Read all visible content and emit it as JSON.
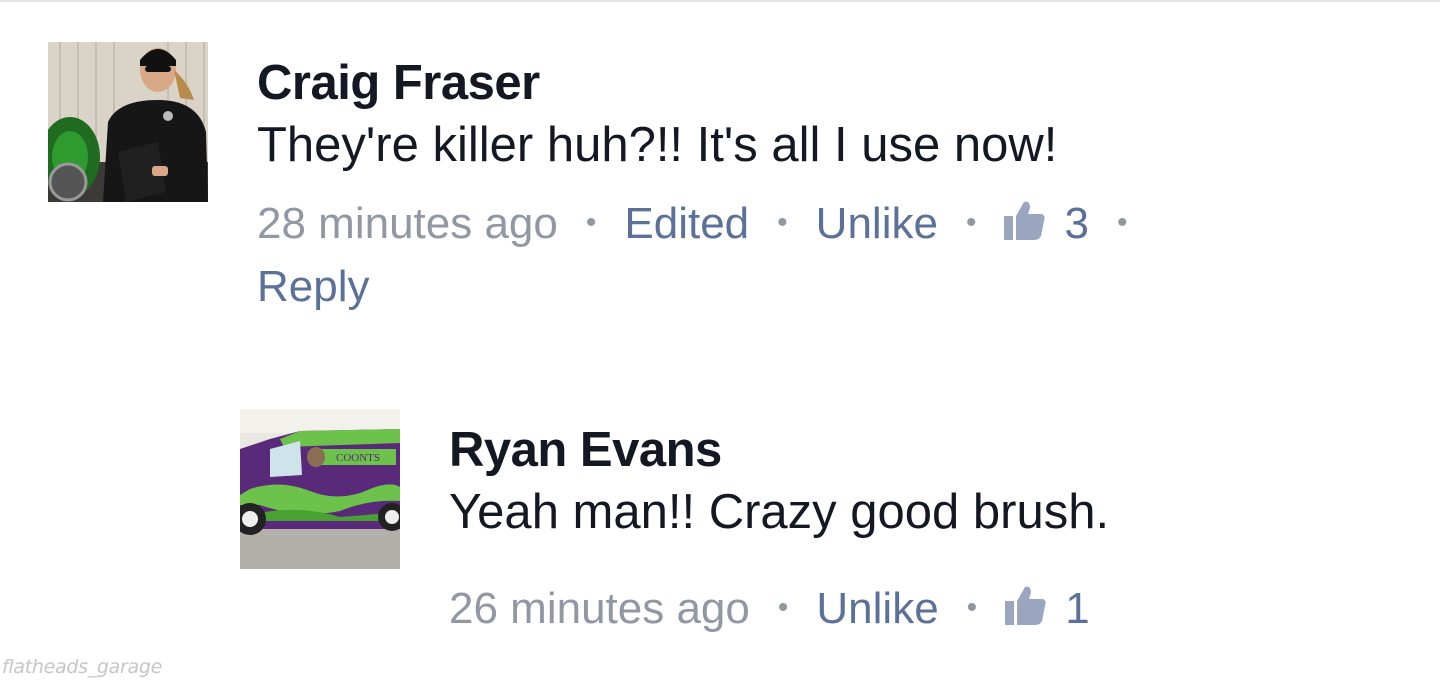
{
  "comments": [
    {
      "author": "Craig Fraser",
      "text": "They're killer huh?!!  It's all I use now!",
      "time": "28 minutes ago",
      "edited": "Edited",
      "unlike": "Unlike",
      "likes": "3",
      "reply": "Reply",
      "avatar_icon": "man-with-motorcycle-avatar"
    },
    {
      "author": "Ryan Evans",
      "text": "Yeah man!! Crazy good brush.",
      "time": "26 minutes ago",
      "unlike": "Unlike",
      "likes": "1",
      "avatar_icon": "purple-green-truck-avatar",
      "avatar_label": "COONTS"
    }
  ],
  "watermark": "flatheads_garage",
  "colors": {
    "text": "#141823",
    "meta_gray": "#9197a3",
    "link_blue": "#5b7199",
    "thumb": "#9aa6c0"
  }
}
